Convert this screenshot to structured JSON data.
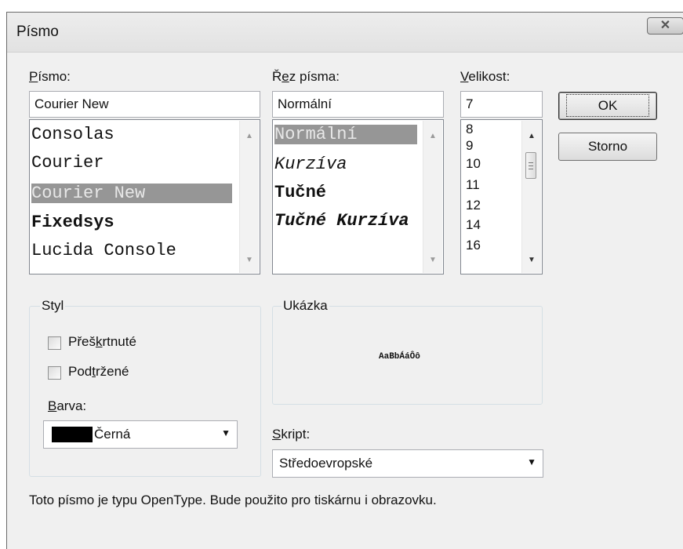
{
  "window": {
    "title": "Písmo",
    "close_symbol": "✕"
  },
  "font": {
    "label_mnemonic": "P",
    "label_rest": "ísmo:",
    "value": "Courier New",
    "items": [
      "Consolas",
      "Courier",
      "Courier New",
      "Fixedsys",
      "Lucida Console"
    ],
    "selected": "Courier New"
  },
  "style": {
    "label_before": "Ř",
    "label_mnemonic": "e",
    "label_rest": "z písma:",
    "value": "Normální",
    "items": [
      "Normální",
      "Kurzíva",
      "Tučné",
      "Tučné Kurzíva"
    ],
    "selected": "Normální"
  },
  "size": {
    "label_mnemonic": "V",
    "label_rest": "elikost:",
    "value": "7",
    "items": [
      "8",
      "9",
      "10",
      "11",
      "12",
      "14",
      "16"
    ]
  },
  "buttons": {
    "ok": "OK",
    "cancel": "Storno"
  },
  "effects": {
    "group_label": "Styl",
    "strikeout": {
      "before": "Přeš",
      "mnemonic": "k",
      "after": "rtnuté",
      "checked": false
    },
    "underline": {
      "before": "Pod",
      "mnemonic": "t",
      "after": "ržené",
      "checked": false
    },
    "color_label_mnemonic": "B",
    "color_label_rest": "arva:",
    "color_value": "Černá",
    "color_hex": "#000000"
  },
  "sample": {
    "group_label": "Ukázka",
    "text": "AaBbÁáÔô"
  },
  "script": {
    "label_mnemonic": "S",
    "label_rest": "kript:",
    "value": "Středoevropské"
  },
  "info_text": "Toto písmo je typu OpenType. Bude použito pro tiskárnu i obrazovku.",
  "icons": {
    "scroll_up": "▲",
    "scroll_down": "▼",
    "dropdown": "▼"
  }
}
